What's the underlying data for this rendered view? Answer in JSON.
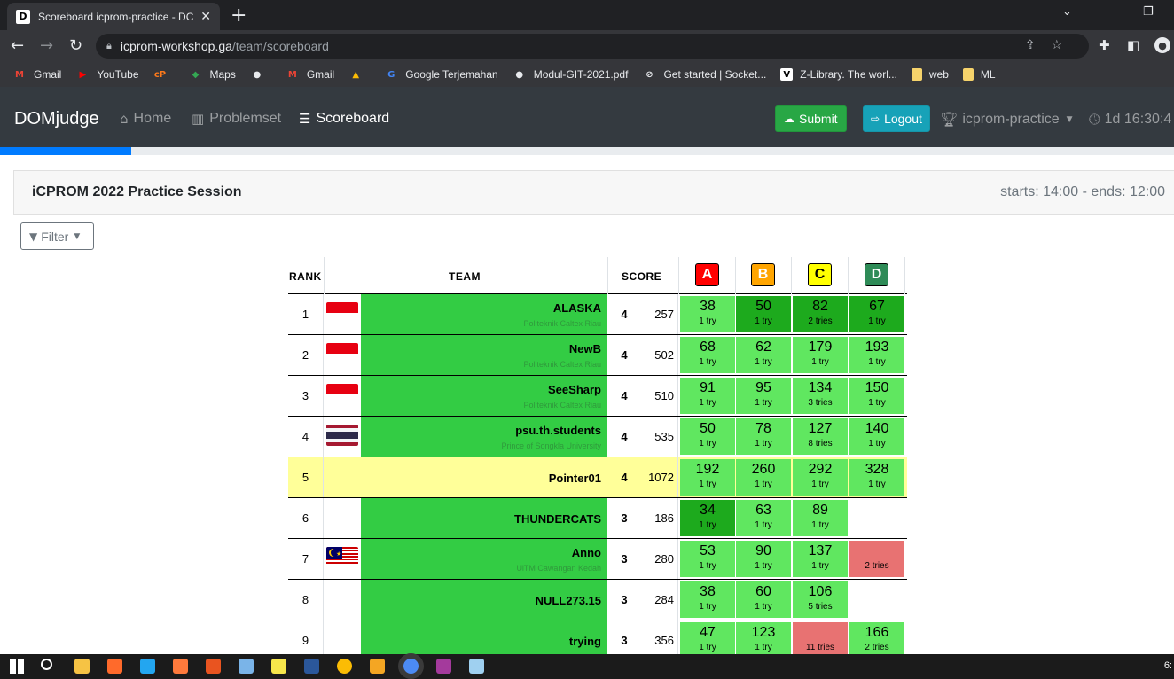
{
  "browser": {
    "tab_title": "Scoreboard icprom-practice - DC",
    "favicon_text": "D",
    "url_host": "icprom-workshop.ga",
    "url_path": "/team/scoreboard",
    "bookmarks": [
      {
        "label": "Gmail",
        "icon": "gmail-icon",
        "color": "#ea4335",
        "glyph": "M"
      },
      {
        "label": "YouTube",
        "icon": "youtube-icon",
        "color": "#ff0000",
        "glyph": "▶"
      },
      {
        "label": "",
        "icon": "cp-icon",
        "color": "#ff7a1a",
        "glyph": "cP"
      },
      {
        "label": "Maps",
        "icon": "maps-icon",
        "color": "#34a853",
        "glyph": "◆"
      },
      {
        "label": "",
        "icon": "globe-icon",
        "color": "#e8eaed",
        "glyph": "●"
      },
      {
        "label": "Gmail",
        "icon": "gmail-icon",
        "color": "#ea4335",
        "glyph": "M"
      },
      {
        "label": "",
        "icon": "drive-icon",
        "color": "#fbbc04",
        "glyph": "▲"
      },
      {
        "label": "Google Terjemahan",
        "icon": "translate-icon",
        "color": "#4285f4",
        "glyph": "G"
      },
      {
        "label": "Modul-GIT-2021.pdf",
        "icon": "globe-icon",
        "color": "#e8eaed",
        "glyph": "●"
      },
      {
        "label": "Get started | Socket...",
        "icon": "socketio-icon",
        "color": "#e8eaed",
        "glyph": "⊘"
      },
      {
        "label": "Z-Library. The worl...",
        "icon": "zlibrary-icon",
        "color": "#ffffff",
        "glyph": "V"
      },
      {
        "label": "web",
        "icon": "folder-icon",
        "color": "#f6d36b",
        "glyph": ""
      },
      {
        "label": "ML",
        "icon": "folder-icon",
        "color": "#f6d36b",
        "glyph": ""
      }
    ]
  },
  "navbar": {
    "brand": "DOMjudge",
    "links": [
      {
        "label": "Home",
        "icon": "home-icon",
        "glyph": "⌂",
        "active": false
      },
      {
        "label": "Problemset",
        "icon": "book-icon",
        "glyph": "▥",
        "active": false
      },
      {
        "label": "Scoreboard",
        "icon": "list-icon",
        "glyph": "☰",
        "active": true
      }
    ],
    "submit_label": "Submit",
    "logout_label": "Logout",
    "team_label": "icprom-practice",
    "timer": "1d 16:30:4"
  },
  "contest": {
    "name": "iCPROM 2022 Practice Session",
    "times": "starts: 14:00 - ends: 12:00",
    "filter_label": "Filter",
    "progress_fraction": 0.112
  },
  "scoreboard": {
    "headers": {
      "rank": "RANK",
      "team": "TEAM",
      "score": "SCORE"
    },
    "problems": [
      {
        "label": "A",
        "color": "#ff0000",
        "text_color": "#ffffff"
      },
      {
        "label": "B",
        "color": "#ffa500",
        "text_color": "#ffffff"
      },
      {
        "label": "C",
        "color": "#ffff00",
        "text_color": "#000000"
      },
      {
        "label": "D",
        "color": "#2e8b57",
        "text_color": "#ffffff"
      }
    ],
    "rows": [
      {
        "rank": "1",
        "flag": "id",
        "team": "ALASKA",
        "affiliation": "Politeknik Caltex Riau",
        "solved": "4",
        "time": "257",
        "self": false,
        "cells": [
          {
            "v": "38",
            "t": "1 try",
            "s": "correct"
          },
          {
            "v": "50",
            "t": "1 try",
            "s": "first"
          },
          {
            "v": "82",
            "t": "2 tries",
            "s": "first"
          },
          {
            "v": "67",
            "t": "1 try",
            "s": "first"
          }
        ]
      },
      {
        "rank": "2",
        "flag": "id",
        "team": "NewB",
        "affiliation": "Politeknik Caltex Riau",
        "solved": "4",
        "time": "502",
        "self": false,
        "cells": [
          {
            "v": "68",
            "t": "1 try",
            "s": "correct"
          },
          {
            "v": "62",
            "t": "1 try",
            "s": "correct"
          },
          {
            "v": "179",
            "t": "1 try",
            "s": "correct"
          },
          {
            "v": "193",
            "t": "1 try",
            "s": "correct"
          }
        ]
      },
      {
        "rank": "3",
        "flag": "id",
        "team": "SeeSharp",
        "affiliation": "Politeknik Caltex Riau",
        "solved": "4",
        "time": "510",
        "self": false,
        "cells": [
          {
            "v": "91",
            "t": "1 try",
            "s": "correct"
          },
          {
            "v": "95",
            "t": "1 try",
            "s": "correct"
          },
          {
            "v": "134",
            "t": "3 tries",
            "s": "correct"
          },
          {
            "v": "150",
            "t": "1 try",
            "s": "correct"
          }
        ]
      },
      {
        "rank": "4",
        "flag": "th",
        "team": "psu.th.students",
        "affiliation": "Prince of Songkla University",
        "solved": "4",
        "time": "535",
        "self": false,
        "cells": [
          {
            "v": "50",
            "t": "1 try",
            "s": "correct"
          },
          {
            "v": "78",
            "t": "1 try",
            "s": "correct"
          },
          {
            "v": "127",
            "t": "8 tries",
            "s": "correct"
          },
          {
            "v": "140",
            "t": "1 try",
            "s": "correct"
          }
        ]
      },
      {
        "rank": "5",
        "flag": "",
        "team": "Pointer01",
        "affiliation": "",
        "solved": "4",
        "time": "1072",
        "self": true,
        "cells": [
          {
            "v": "192",
            "t": "1 try",
            "s": "correct"
          },
          {
            "v": "260",
            "t": "1 try",
            "s": "correct"
          },
          {
            "v": "292",
            "t": "1 try",
            "s": "correct"
          },
          {
            "v": "328",
            "t": "1 try",
            "s": "correct"
          }
        ]
      },
      {
        "rank": "6",
        "flag": "",
        "team": "THUNDERCATS",
        "affiliation": "",
        "solved": "3",
        "time": "186",
        "self": false,
        "cells": [
          {
            "v": "34",
            "t": "1 try",
            "s": "first"
          },
          {
            "v": "63",
            "t": "1 try",
            "s": "correct"
          },
          {
            "v": "89",
            "t": "1 try",
            "s": "correct"
          },
          {
            "v": "",
            "t": "",
            "s": "none"
          }
        ]
      },
      {
        "rank": "7",
        "flag": "my",
        "team": "Anno",
        "affiliation": "UiTM Cawangan Kedah",
        "solved": "3",
        "time": "280",
        "self": false,
        "cells": [
          {
            "v": "53",
            "t": "1 try",
            "s": "correct"
          },
          {
            "v": "90",
            "t": "1 try",
            "s": "correct"
          },
          {
            "v": "137",
            "t": "1 try",
            "s": "correct"
          },
          {
            "v": "",
            "t": "2 tries",
            "s": "failed"
          }
        ]
      },
      {
        "rank": "8",
        "flag": "",
        "team": "NULL273.15",
        "affiliation": "",
        "solved": "3",
        "time": "284",
        "self": false,
        "cells": [
          {
            "v": "38",
            "t": "1 try",
            "s": "correct"
          },
          {
            "v": "60",
            "t": "1 try",
            "s": "correct"
          },
          {
            "v": "106",
            "t": "5 tries",
            "s": "correct"
          },
          {
            "v": "",
            "t": "",
            "s": "none"
          }
        ]
      },
      {
        "rank": "9",
        "flag": "",
        "team": "trying",
        "affiliation": "",
        "solved": "3",
        "time": "356",
        "self": false,
        "cells": [
          {
            "v": "47",
            "t": "1 try",
            "s": "correct"
          },
          {
            "v": "123",
            "t": "1 try",
            "s": "correct"
          },
          {
            "v": "",
            "t": "11 tries",
            "s": "failed"
          },
          {
            "v": "166",
            "t": "2 tries",
            "s": "correct"
          }
        ]
      }
    ]
  },
  "taskbar": {
    "clock": "6:",
    "icons": [
      {
        "name": "windows-start-icon",
        "color": "#ffffff"
      },
      {
        "name": "search-icon",
        "color": "#ffffff"
      },
      {
        "name": "file-explorer-icon",
        "color": "#f6c344"
      },
      {
        "name": "app-icon",
        "color": "#ff6a2b"
      },
      {
        "name": "vscode-icon",
        "color": "#23a6f0"
      },
      {
        "name": "app-icon",
        "color": "#ff7a3c"
      },
      {
        "name": "ubuntu-icon",
        "color": "#e95420"
      },
      {
        "name": "virtualbox-icon",
        "color": "#7ab4e8"
      },
      {
        "name": "sticky-notes-icon",
        "color": "#f7e64b"
      },
      {
        "name": "word-icon",
        "color": "#2b579a"
      },
      {
        "name": "chrome-icon",
        "color": "#fbbc04"
      },
      {
        "name": "git-icon",
        "color": "#f4a623"
      },
      {
        "name": "chrome-icon",
        "color": "#4c8bf5"
      },
      {
        "name": "winrar-icon",
        "color": "#a43a9c"
      },
      {
        "name": "notepad-icon",
        "color": "#9fd0f0"
      }
    ]
  }
}
